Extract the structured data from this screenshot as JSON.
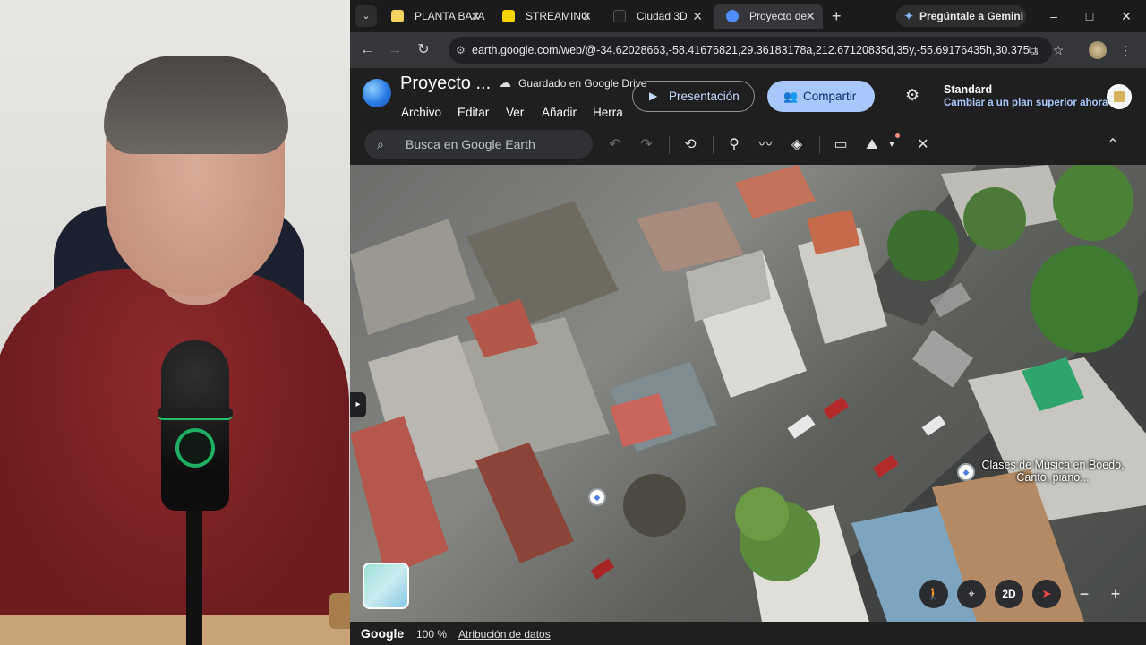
{
  "tabs": [
    {
      "label": "PLANTA BAJA",
      "favicon_color": "#f4d35e"
    },
    {
      "label": "STREAMING",
      "favicon_color": "#f6d400"
    },
    {
      "label": "Ciudad 3D",
      "favicon_color": "#222222"
    },
    {
      "label": "Proyecto de",
      "favicon_color": "#4e8cf7",
      "active": true
    }
  ],
  "tab_new_symbol": "+",
  "gemini_label": "Pregúntale a Gemini",
  "window_controls": {
    "minimize": "–",
    "maximize": "□",
    "close": "✕"
  },
  "address": {
    "url": "earth.google.com/web/@-34.62028663,-58.41676821,29.36183178a,212.67120835d,35y,-55.69176435h,30.375..."
  },
  "earth": {
    "project_title": "Proyecto ...",
    "saved_status": "Guardado en Google Drive",
    "menus": [
      "Archivo",
      "Editar",
      "Ver",
      "Añadir",
      "Herra"
    ],
    "presentation_label": "Presentación",
    "share_label": "Compartir",
    "plan_name": "Standard",
    "plan_upgrade": "Cambiar a un plan superior ahora",
    "search_placeholder": "Busca en Google Earth"
  },
  "map": {
    "place_label": "Clases de Música en Boedo, Canto, piano...",
    "controls": {
      "view_mode": "2D"
    }
  },
  "status": {
    "google": "Google",
    "zoom": "100 %",
    "attribution": "Atribución de datos"
  }
}
